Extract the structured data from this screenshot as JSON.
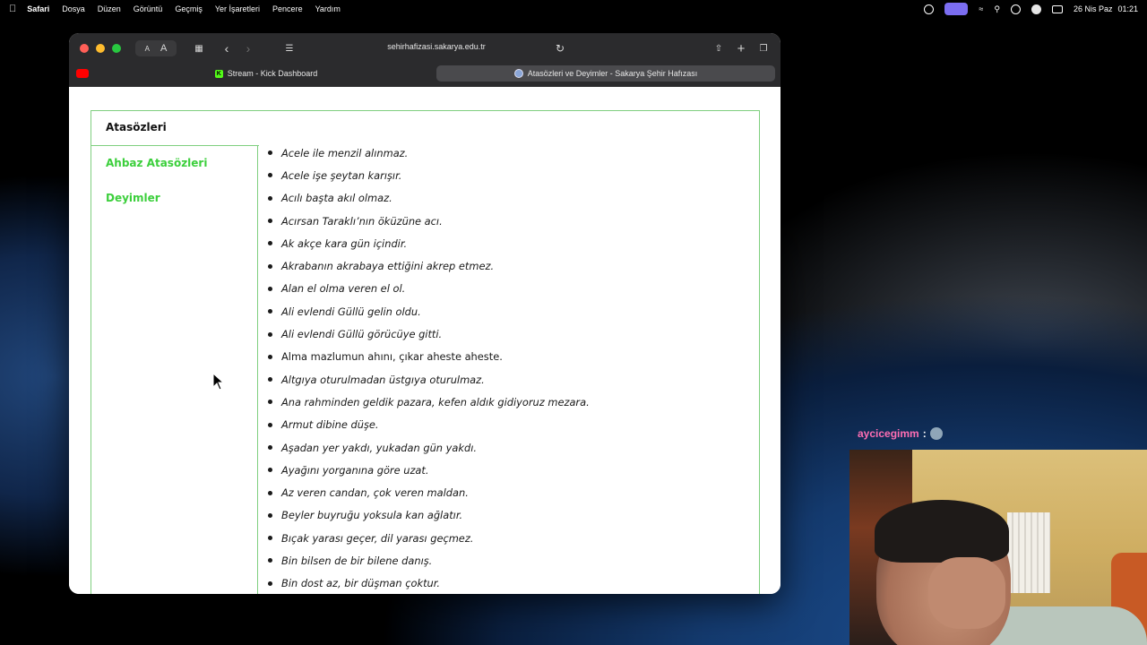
{
  "menubar": {
    "app_name": "Safari",
    "items": [
      "Dosya",
      "Düzen",
      "Görüntü",
      "Geçmiş",
      "Yer İşaretleri",
      "Pencere",
      "Yardım"
    ],
    "date": "26 Nis Paz",
    "time": "01:21"
  },
  "browser": {
    "url": "sehirhafizasi.sakarya.edu.tr",
    "text_size_small": "A",
    "text_size_large": "A",
    "tabs": [
      {
        "label": "Stream - Kick Dashboard",
        "icon": "kick-icon"
      },
      {
        "label": "Atasözleri ve Deyimler - Sakarya Şehir Hafızası",
        "icon": "site-icon"
      }
    ]
  },
  "page": {
    "side_tabs": [
      {
        "label": "Atasözleri",
        "active": true
      },
      {
        "label": "Ahbaz Atasözleri",
        "active": false
      },
      {
        "label": "Deyimler",
        "active": false
      }
    ],
    "proverbs": [
      "Acele ile menzil alınmaz.",
      "Acele işe şeytan karışır.",
      "Acılı başta akıl olmaz.",
      "Acırsan Taraklı’nın öküzüne acı.",
      "Ak akçe kara gün içindir.",
      "Akrabanın akrabaya ettiğini akrep etmez.",
      "Alan el olma veren el ol.",
      "Ali evlendi Güllü gelin oldu.",
      "Ali evlendi Güllü görücüye gitti.",
      "Alma mazlumun ahını, çıkar aheste aheste.",
      "Altgıya oturulmadan üstgıya oturulmaz.",
      "Ana rahminden geldik pazara, kefen aldık gidiyoruz mezara.",
      "Armut dibine düşe.",
      "Aşadan yer yakdı, yukadan gün yakdı.",
      "Ayağını yorganına göre uzat.",
      "Az veren candan, çok veren maldan.",
      "Beyler buyruğu yoksula kan ağlatır.",
      "Bıçak yarası geçer, dil yarası geçmez.",
      "Bin bilsen de bir bilene danış.",
      "Bin dost az, bir düşman çoktur."
    ]
  },
  "chat": {
    "username": "aycicegimm",
    "separator": ":"
  },
  "colors": {
    "accent_green": "#3ccf3c",
    "border_green": "#7fcf7f",
    "chat_username": "#ff6eb4"
  }
}
